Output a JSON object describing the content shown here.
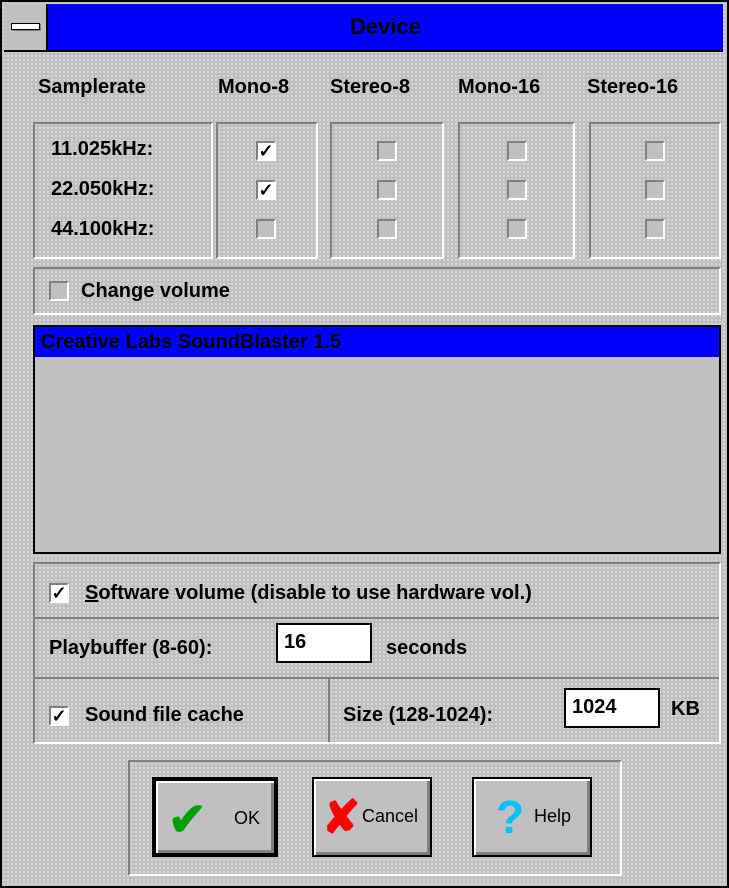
{
  "window": {
    "title": "Device"
  },
  "columns": [
    "Samplerate",
    "Mono-8",
    "Stereo-8",
    "Mono-16",
    "Stereo-16"
  ],
  "rates": [
    {
      "label": "11.025kHz:",
      "mono8": true,
      "stereo8": false,
      "mono16": false,
      "stereo16": false
    },
    {
      "label": "22.050kHz:",
      "mono8": true,
      "stereo8": false,
      "mono16": false,
      "stereo16": false
    },
    {
      "label": "44.100kHz:",
      "mono8": false,
      "stereo8": false,
      "mono16": false,
      "stereo16": false
    }
  ],
  "change_volume": {
    "label": "Change volume",
    "checked": false
  },
  "device_list": {
    "selected": "Creative Labs SoundBlaster 1.5"
  },
  "software_volume": {
    "label_accel": "S",
    "label_rest": "oftware volume (disable to use hardware vol.)",
    "checked": true
  },
  "playbuffer": {
    "label": "Playbuffer (8-60):",
    "value": "16",
    "unit": "seconds"
  },
  "cache": {
    "label": "Sound file cache",
    "checked": true,
    "size_label": "Size (128-1024):",
    "size_value": "1024",
    "size_unit": "KB"
  },
  "buttons": {
    "ok": {
      "label": "OK",
      "icon": "checkmark-icon",
      "color": "#00a000"
    },
    "cancel": {
      "label": "Cancel",
      "icon": "x-icon",
      "color": "#ff0000"
    },
    "help": {
      "label": "Help",
      "icon": "question-icon",
      "color": "#00c0ff"
    }
  },
  "check_glyph": "✓"
}
